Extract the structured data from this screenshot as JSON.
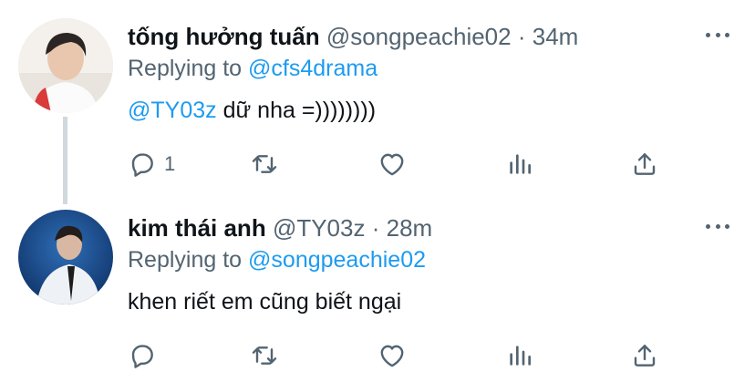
{
  "tweets": [
    {
      "display_name": "tống hưởng tuấn",
      "handle": "@songpeachie02",
      "separator": "·",
      "time": "34m",
      "replying_prefix": "Replying to",
      "replying_to": "@cfs4drama",
      "text_mention": "@TY03z",
      "text_body": " dữ nha =))))))))",
      "reply_count": "1",
      "retweet_count": "",
      "like_count": ""
    },
    {
      "display_name": "kim thái anh",
      "handle": "@TY03z",
      "separator": "·",
      "time": "28m",
      "replying_prefix": "Replying to",
      "replying_to": "@songpeachie02",
      "text_mention": "",
      "text_body": "khen riết em cũng biết ngại",
      "reply_count": "",
      "retweet_count": "",
      "like_count": ""
    }
  ],
  "colors": {
    "link": "#1d9bf0",
    "secondary_text": "#536471",
    "primary_text": "#0f1419",
    "thread_line": "#cfd9de"
  },
  "icons": [
    "avatar",
    "more-icon",
    "reply-icon",
    "retweet-icon",
    "like-icon",
    "analytics-icon",
    "share-icon"
  ]
}
